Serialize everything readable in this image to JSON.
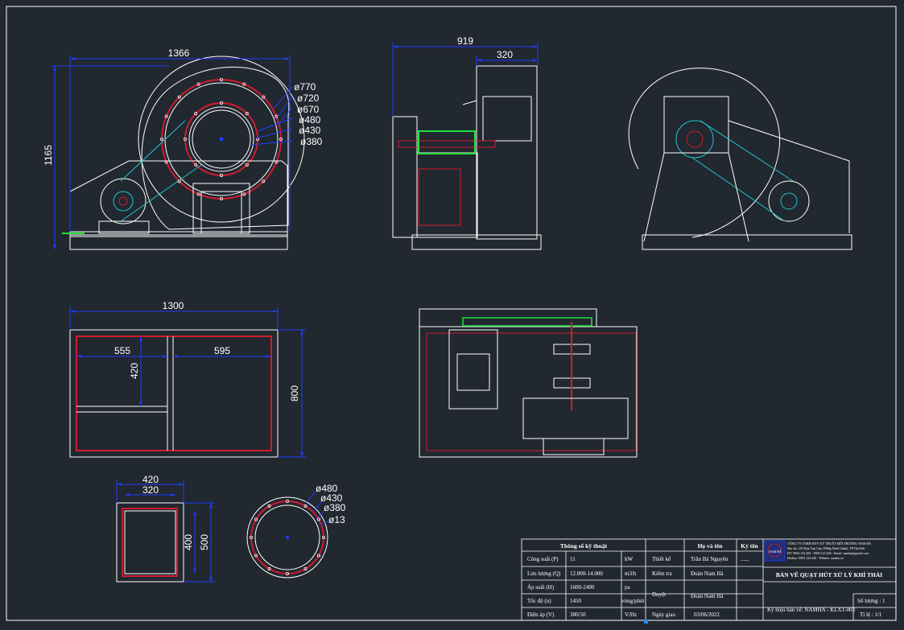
{
  "dimensions": {
    "front_width": "1366",
    "front_height": "1165",
    "circle_d770": "ø770",
    "circle_d720": "ø720",
    "circle_d670": "ø670",
    "circle_d480": "ø480",
    "circle_d430": "ø430",
    "circle_d380": "ø380",
    "side_width": "919",
    "side_inner": "320",
    "base_width": "1300",
    "base_left": "555",
    "base_right": "595",
    "base_inner_height": "420",
    "base_height": "800",
    "flange_outer_w": "420",
    "flange_inner_w": "320",
    "flange_inner_h": "400",
    "flange_outer_h": "500",
    "round_d480": "ø480",
    "round_d430": "ø430",
    "round_d380": "ø380",
    "round_d13": "ø13"
  },
  "title_block": {
    "spec_header": "Thông số kỹ thuật",
    "specs": [
      {
        "label": "Công suất (P)",
        "value": "11",
        "unit": "kW"
      },
      {
        "label": "Lưu lượng (Q)",
        "value": "12.000-14.000",
        "unit": "m3/h"
      },
      {
        "label": "Áp suất (H)",
        "value": "1600-2400",
        "unit": "pa"
      },
      {
        "label": "Tốc độ (n)",
        "value": "1450",
        "unit": "vòng/phút"
      },
      {
        "label": "Điện áp (V)",
        "value": "380/50",
        "unit": "V/Hz"
      }
    ],
    "signers_header": "Họ và tên",
    "sign_header": "Ký tên",
    "roles": [
      {
        "role": "Thiết kế",
        "name": "Trần Bá Nguyên",
        "sign": "......"
      },
      {
        "role": "Kiểm tra",
        "name": "Đoàn Nam Hà",
        "sign": ""
      },
      {
        "role": "Duyệt",
        "name": "Đoàn Nam Hà",
        "sign": ""
      },
      {
        "role": "Ngày giao",
        "name": "03/06/2022",
        "sign": ""
      }
    ],
    "company_lines": [
      "CÔNG TY TNHH MTV KỸ THUẬT MÔI TRƯỜNG NAM HÀ",
      "Địa chỉ: 255 Kha Vạn Cân, P.Hiệp Bình Chánh, TP.Thủ Đức",
      "ĐT: 0903.123.456 - 0903.123.456 - Email: namha@gmail.com",
      "Hotline: 0903.123.456 - Website: namha.vn"
    ],
    "logo_text": "NAM HÀ",
    "drawing_title": "BẢN VẼ QUẠT HÚT XỬ LÝ KHÍ THẢI",
    "drawing_code": "Ký hiệu bản vẽ: NAMHA - KLXT-003",
    "quantity": "Số lượng : 1",
    "scale": "Tỉ lệ : 1/1"
  },
  "colors": {
    "background": "#212830",
    "line": "#ffffff",
    "dimension": "#1f3dff",
    "hidden": "#d21b2e",
    "belt": "#23c4d0",
    "motor": "#23e03a"
  }
}
